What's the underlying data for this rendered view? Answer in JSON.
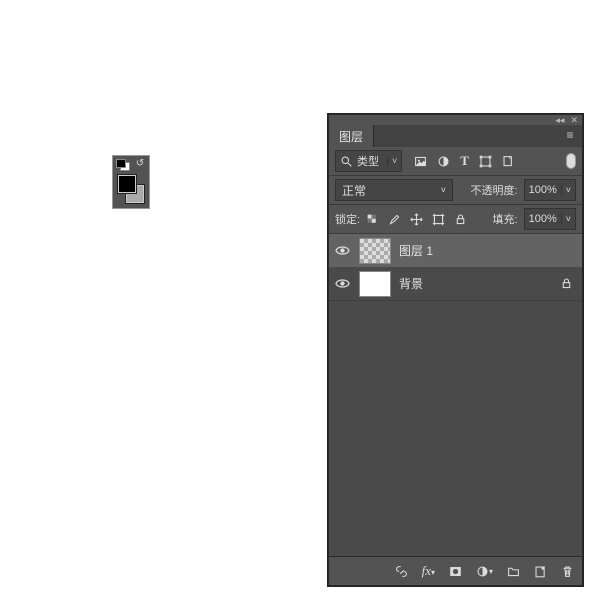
{
  "color_tool": {
    "foreground": "#000000",
    "background": "#aaaaaa"
  },
  "panel": {
    "tab_label": "图层",
    "filter": {
      "type_label": "类型"
    },
    "blend": {
      "mode": "正常",
      "opacity_label": "不透明度:",
      "opacity_value": "100%"
    },
    "lock": {
      "label": "锁定:",
      "fill_label": "填充:",
      "fill_value": "100%"
    },
    "layers": [
      {
        "name": "图层 1",
        "visible": true,
        "thumb": "transparent",
        "selected": true,
        "locked": false
      },
      {
        "name": "背景",
        "visible": true,
        "thumb": "white",
        "selected": false,
        "locked": true
      }
    ]
  }
}
